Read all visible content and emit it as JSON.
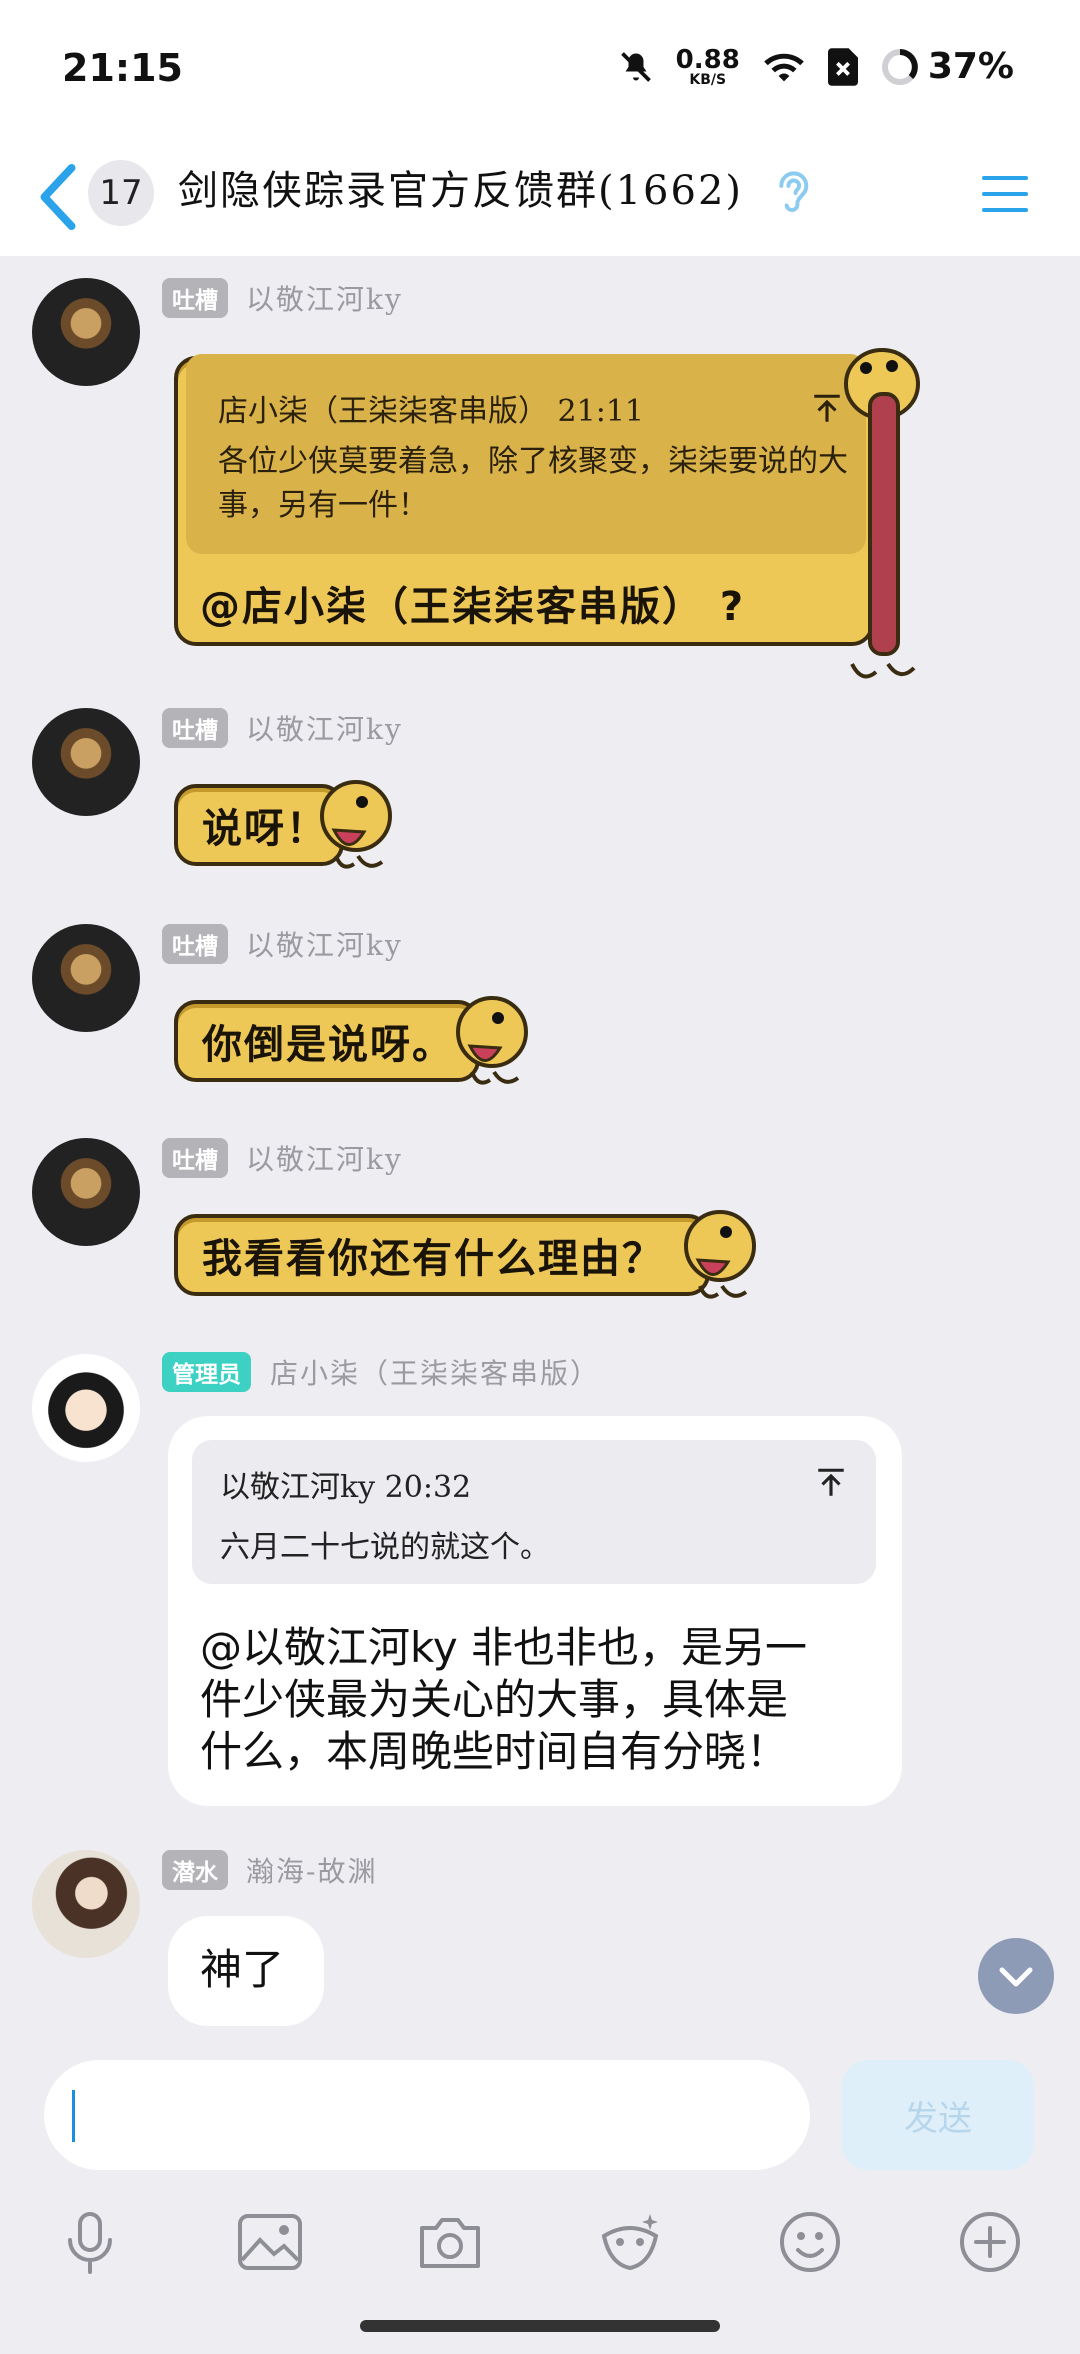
{
  "status": {
    "time": "21:15",
    "speed_value": "0.88",
    "speed_unit": "KB/S",
    "battery": "37%"
  },
  "header": {
    "unread_count": "17",
    "title": "剑隐侠踪录官方反馈群(1662)"
  },
  "messages": [
    {
      "tag": "吐槽",
      "nick": "以敬江河ky",
      "quote_head": "店小柒（王柒柒客串版） 21:11",
      "quote_body": "各位少侠莫要着急，除了核聚变，柒柒要说的大事，另有一件！",
      "text": "@店小柒（王柒柒客串版） ?"
    },
    {
      "tag": "吐槽",
      "nick": "以敬江河ky",
      "text": "说呀！"
    },
    {
      "tag": "吐槽",
      "nick": "以敬江河ky",
      "text": "你倒是说呀。"
    },
    {
      "tag": "吐槽",
      "nick": "以敬江河ky",
      "text": "我看看你还有什么理由？"
    },
    {
      "tag": "管理员",
      "nick": "店小柒（王柒柒客串版）",
      "quote_head": "以敬江河ky 20:32",
      "quote_body": "六月二十七说的就这个。",
      "lines": [
        "@以敬江河ky  非也非也，是另一",
        "件少侠最为关心的大事，具体是",
        "什么，本周晚些时间自有分晓！"
      ]
    },
    {
      "tag": "潜水",
      "nick": "瀚海-故渊",
      "text": "神了"
    }
  ],
  "input": {
    "send_label": "发送"
  },
  "toolbar": [
    "microphone-icon",
    "image-icon",
    "camera-icon",
    "sticker-icon",
    "emoji-icon",
    "plus-icon"
  ],
  "colors": {
    "accent": "#1a8fe3",
    "admin_tag": "#3dd1c4",
    "role_tag": "#b3b3b8",
    "sticker_bubble": "#eec857"
  }
}
